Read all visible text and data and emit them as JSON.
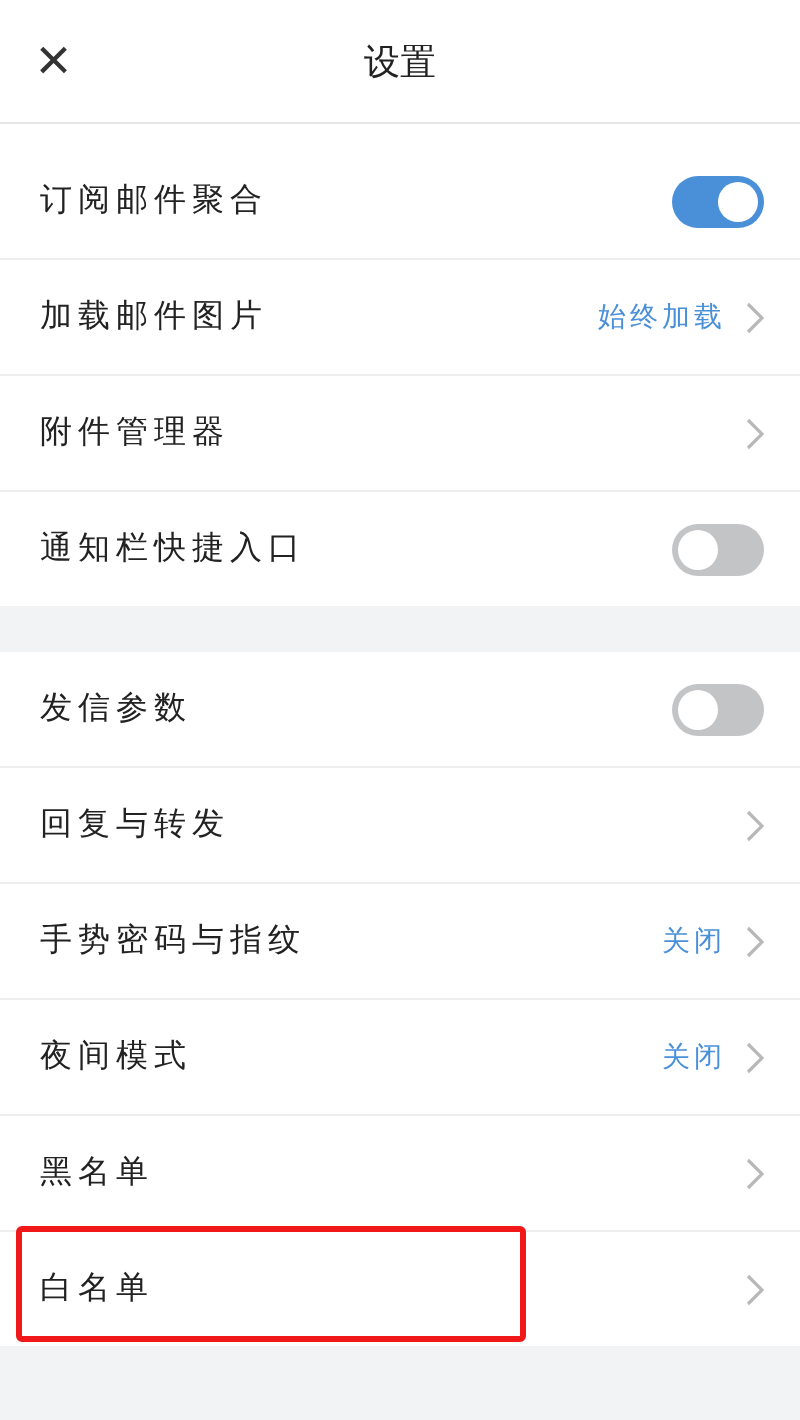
{
  "header": {
    "close": "×",
    "title": "设置"
  },
  "sections": [
    {
      "items": [
        {
          "kind": "toggle",
          "label": "订阅邮件聚合",
          "on": true
        },
        {
          "kind": "link",
          "label": "加载邮件图片",
          "value": "始终加载"
        },
        {
          "kind": "link",
          "label": "附件管理器"
        },
        {
          "kind": "toggle",
          "label": "通知栏快捷入口",
          "on": false
        }
      ]
    },
    {
      "items": [
        {
          "kind": "toggle",
          "label": "发信参数",
          "on": false
        },
        {
          "kind": "link",
          "label": "回复与转发"
        },
        {
          "kind": "link",
          "label": "手势密码与指纹",
          "value": "关闭"
        },
        {
          "kind": "link",
          "label": "夜间模式",
          "value": "关闭"
        },
        {
          "kind": "link",
          "label": "黑名单"
        },
        {
          "kind": "link",
          "label": "白名单",
          "highlighted": true
        }
      ]
    }
  ]
}
